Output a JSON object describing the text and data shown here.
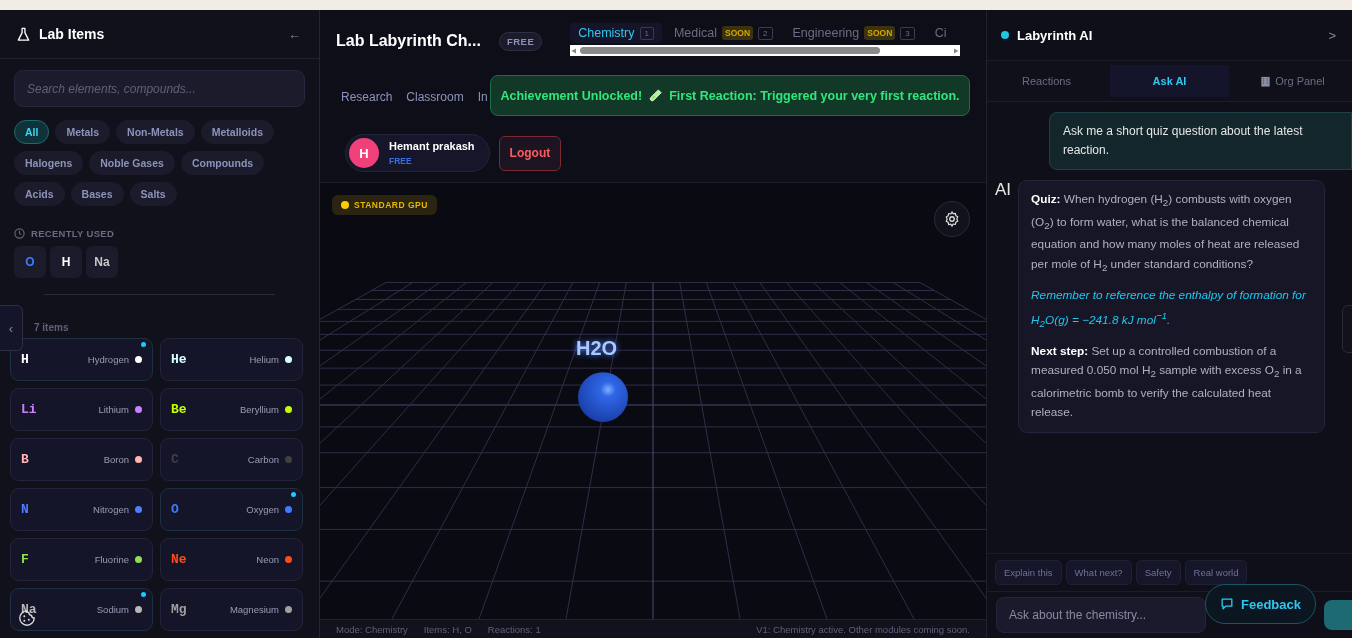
{
  "left_panel": {
    "title": "Lab Items",
    "collapse_label": "←",
    "search": {
      "placeholder": "Search elements, compounds..."
    },
    "filters": [
      {
        "label": "All",
        "selected": true
      },
      {
        "label": "Metals",
        "selected": false
      },
      {
        "label": "Non-Metals",
        "selected": false
      },
      {
        "label": "Metalloids",
        "selected": false
      },
      {
        "label": "Halogens",
        "selected": false
      },
      {
        "label": "Noble Gases",
        "selected": false
      },
      {
        "label": "Compounds",
        "selected": false
      },
      {
        "label": "Acids",
        "selected": false
      },
      {
        "label": "Bases",
        "selected": false
      },
      {
        "label": "Salts",
        "selected": false
      }
    ],
    "recent_heading": "RECENTLY USED",
    "recent": [
      {
        "symbol": "O",
        "color": "#3d7bff"
      },
      {
        "symbol": "H",
        "color": "#ffffff"
      },
      {
        "symbol": "Na",
        "color": "#c8c8c8"
      }
    ],
    "count_label": "7 items",
    "side_tab": "‹",
    "elements": [
      {
        "symbol": "H",
        "name": "Hydrogen",
        "color": "#ffffff",
        "recent": true
      },
      {
        "symbol": "He",
        "name": "Helium",
        "color": "#d9ffff",
        "recent": false
      },
      {
        "symbol": "Li",
        "name": "Lithium",
        "color": "#cc80ff",
        "recent": false
      },
      {
        "symbol": "Be",
        "name": "Beryllium",
        "color": "#c2ff00",
        "recent": false
      },
      {
        "symbol": "B",
        "name": "Boron",
        "color": "#ffb5b5",
        "recent": false
      },
      {
        "symbol": "C",
        "name": "Carbon",
        "color": "#404040",
        "recent": false
      },
      {
        "symbol": "N",
        "name": "Nitrogen",
        "color": "#4f7dff",
        "recent": false
      },
      {
        "symbol": "O",
        "name": "Oxygen",
        "color": "#3d7bff",
        "recent": true
      },
      {
        "symbol": "F",
        "name": "Fluorine",
        "color": "#90e050",
        "recent": false
      },
      {
        "symbol": "Ne",
        "name": "Neon",
        "color": "#ff4a1a",
        "recent": false
      },
      {
        "symbol": "Na",
        "name": "Sodium",
        "color": "#b8b8b8",
        "recent": true
      },
      {
        "symbol": "Mg",
        "name": "Magnesium",
        "color": "#a0a0a0",
        "recent": false
      }
    ]
  },
  "header": {
    "title": "Lab Labyrinth Ch...",
    "plan_badge": "FREE",
    "modules": [
      {
        "label": "Chemistry",
        "index": "1",
        "selected": true
      },
      {
        "label": "Medical",
        "badge": "SOON",
        "index": "2",
        "selected": false
      },
      {
        "label": "Engineering",
        "badge": "SOON",
        "index": "3",
        "selected": false
      },
      {
        "label": "Ci",
        "selected": false
      }
    ],
    "nav": [
      "Research",
      "Classroom",
      "In"
    ],
    "toast": {
      "title": "Achievement Unlocked!",
      "message": "First Reaction: Triggered your very first reaction."
    },
    "user": {
      "initial": "H",
      "name": "Hemant prakash",
      "plan": "FREE"
    },
    "logout": "Logout"
  },
  "viewport": {
    "gpu_badge": "STANDARD GPU",
    "molecule_label": "H2O"
  },
  "status_bar": {
    "items": [
      "Mode: Chemistry",
      "Items: H, O",
      "Reactions: 1"
    ],
    "note": "V1: Chemistry active. Other modules coming soon."
  },
  "right_panel": {
    "title": "Labyrinth AI",
    "collapse_label": ">",
    "tabs": [
      {
        "label": "Reactions",
        "selected": false,
        "kind": "plain"
      },
      {
        "label": "Ask AI",
        "selected": true,
        "kind": "plain"
      },
      {
        "label": "Org Panel",
        "selected": false,
        "kind": "org"
      }
    ],
    "messages": [
      {
        "kind": "user",
        "paragraphs": [
          {
            "kind": "text",
            "text": "Ask me a short quiz question about the latest reaction."
          }
        ]
      },
      {
        "kind": "ai",
        "sender": "AI",
        "paragraphs": [
          {
            "kind": "text",
            "text": "**Quiz:** When hydrogen (H$_{2}$) combusts with oxygen (O$_{2}$) to form water, what is the balanced chemical equation and how many moles of heat are released per mole of H$_{2}$ under standard conditions?"
          },
          {
            "kind": "hint",
            "text": "Remember to reference the enthalpy of formation for H$_{2}$O(g) = −241.8 kJ mol$^{−1}$."
          },
          {
            "kind": "text",
            "text": "**Next step:** Set up a controlled combustion of a measured 0.050 mol H$_{2}$ sample with excess O$_{2}$ in a calorimetric bomb to verify the calculated heat release."
          }
        ]
      }
    ],
    "quick_prompts": [
      "Explain this",
      "What next?",
      "Safety",
      "Real world"
    ],
    "input": {
      "placeholder": "Ask about the chemistry..."
    }
  },
  "feedback_button": "Feedback"
}
